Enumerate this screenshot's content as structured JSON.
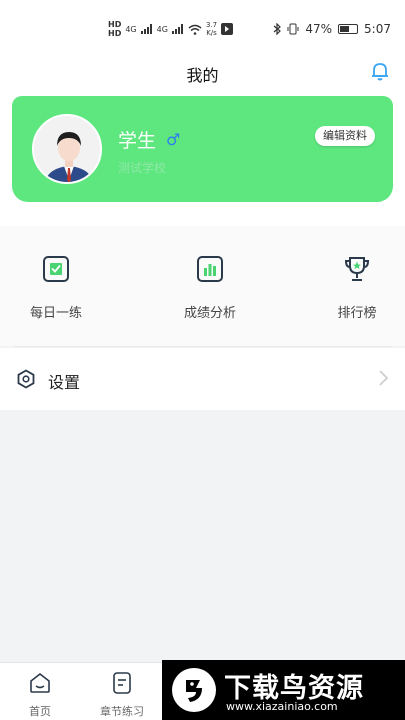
{
  "status_bar": {
    "hd1": "HD",
    "hd2": "HD",
    "net1": "4G",
    "net2": "4G",
    "speed_value": "3.7",
    "speed_unit": "K/s",
    "battery": "47%",
    "time": "5:07"
  },
  "header": {
    "title": "我的"
  },
  "profile": {
    "name": "学生",
    "gender_symbol": "♂",
    "school": "测试学校",
    "edit_label": "编辑资料"
  },
  "features": [
    {
      "label": "每日一练",
      "icon": "daily-check-icon"
    },
    {
      "label": "成绩分析",
      "icon": "bar-chart-icon"
    },
    {
      "label": "排行榜",
      "icon": "trophy-icon"
    }
  ],
  "settings": {
    "label": "设置",
    "icon": "hexagon-settings-icon"
  },
  "tabbar": [
    {
      "label": "首页",
      "icon": "home-icon"
    },
    {
      "label": "章节练习",
      "icon": "chapter-doc-icon"
    }
  ],
  "watermark": {
    "text": "下载鸟资源",
    "url": "www.xiazainiao.com"
  },
  "colors": {
    "accent_green": "#5ee67f",
    "icon_dark": "#2b3a4a",
    "icon_green": "#4ad371"
  }
}
